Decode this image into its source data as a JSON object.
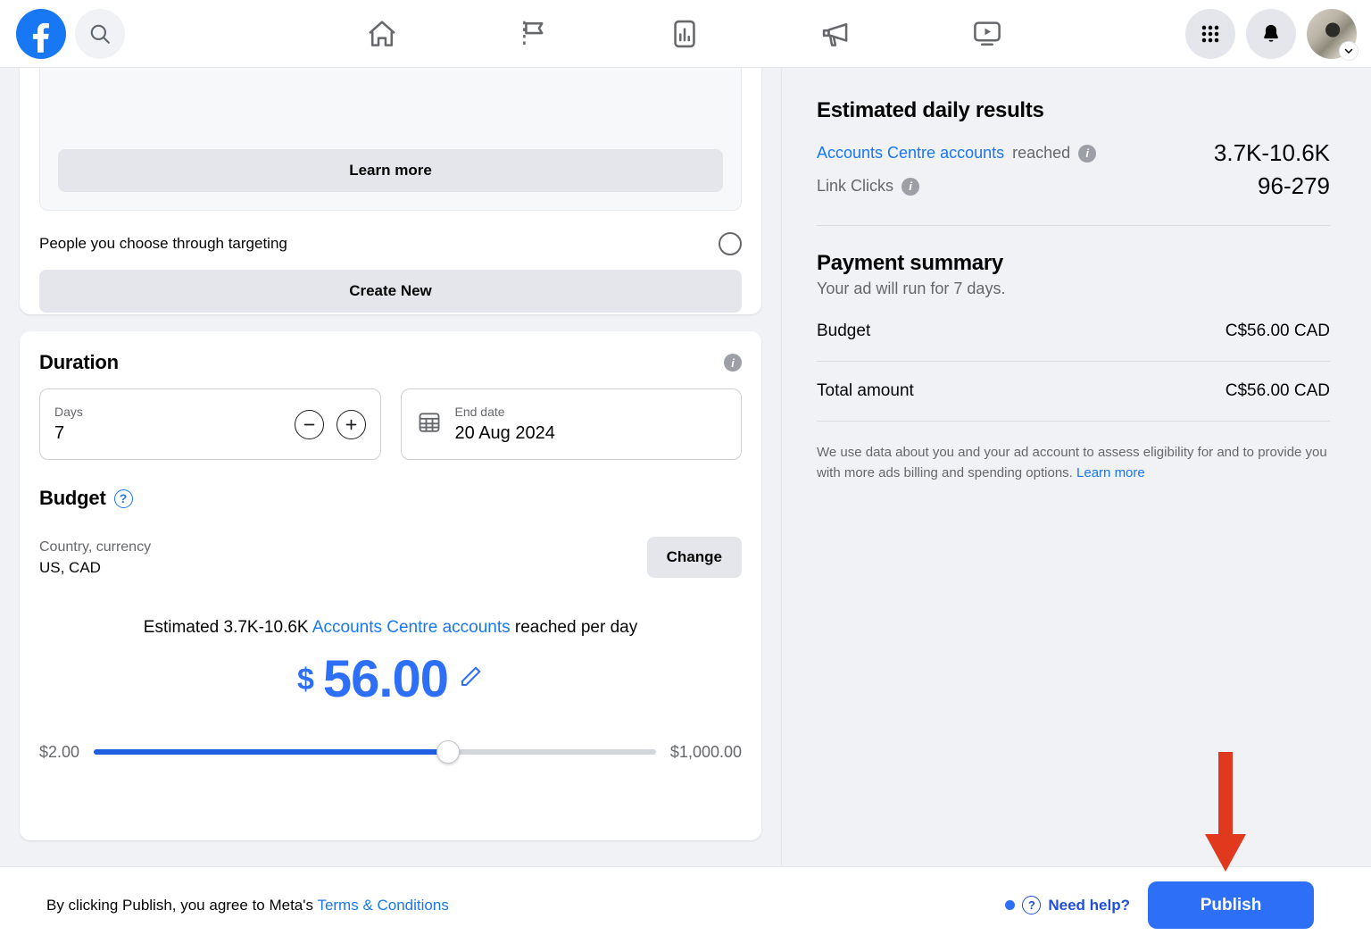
{
  "topnav": {
    "logo_icon": "facebook-logo-icon",
    "search_icon": "search-icon",
    "tabs": [
      {
        "name": "home",
        "icon": "home-icon"
      },
      {
        "name": "pages",
        "icon": "flag-icon"
      },
      {
        "name": "insights",
        "icon": "bar-chart-icon"
      },
      {
        "name": "ads",
        "icon": "megaphone-icon"
      },
      {
        "name": "video",
        "icon": "video-player-icon"
      }
    ],
    "menu_icon": "grid-menu-icon",
    "notifications_icon": "bell-icon",
    "avatar_icon": "avatar",
    "avatar_caret_icon": "chevron-down-icon"
  },
  "audience_card": {
    "learn_more_label": "Learn more",
    "targeting_option_label": "People you choose through targeting",
    "targeting_selected": false,
    "create_new_label": "Create New"
  },
  "duration": {
    "title": "Duration",
    "info_icon": "info-icon",
    "days_label": "Days",
    "days_value": "7",
    "decrement_icon": "minus-circle-icon",
    "increment_icon": "plus-circle-icon",
    "calendar_icon": "calendar-icon",
    "end_date_label": "End date",
    "end_date_value": "20 Aug 2024"
  },
  "budget": {
    "title": "Budget",
    "help_icon": "question-circle-icon",
    "country_currency_label": "Country, currency",
    "country_currency_value": "US, CAD",
    "change_label": "Change",
    "estimate_prefix": "Estimated 3.7K-10.6K",
    "estimate_link": "Accounts Centre accounts",
    "estimate_suffix": "reached per day",
    "currency_symbol": "$",
    "amount": "56.00",
    "edit_icon": "pencil-icon",
    "slider_min_label": "$2.00",
    "slider_max_label": "$1,000.00",
    "slider_percent": "63"
  },
  "results_panel": {
    "title": "Estimated daily results",
    "rows": [
      {
        "link_label": "Accounts Centre accounts",
        "label": "reached",
        "info_icon": "info-icon",
        "value": "3.7K-10.6K"
      },
      {
        "link_label": "",
        "label": "Link Clicks",
        "info_icon": "info-icon",
        "value": "96-279"
      }
    ]
  },
  "payment_panel": {
    "title": "Payment summary",
    "subtitle": "Your ad will run for 7 days.",
    "budget_label": "Budget",
    "budget_value": "C$56.00 CAD",
    "total_label": "Total amount",
    "total_value": "C$56.00 CAD",
    "note_text": "We use data about you and your ad account to assess eligibility for and to provide you with more ads billing and spending options.",
    "note_link": "Learn more"
  },
  "bottombar": {
    "terms_prefix": "By clicking Publish, you agree to Meta's",
    "terms_link": "Terms & Conditions",
    "need_help_label": "Need help?",
    "help_icon": "question-circle-icon",
    "publish_label": "Publish"
  },
  "annotation": {
    "arrow_icon": "red-down-arrow-icon",
    "arrow_color": "#e0391d"
  },
  "colors": {
    "brand_blue": "#1877f2",
    "accent_blue": "#2d6ff7",
    "page_bg": "#f0f2f5",
    "card_bg": "#ffffff",
    "muted_text": "#65676b",
    "annotation_red": "#e0391d"
  }
}
